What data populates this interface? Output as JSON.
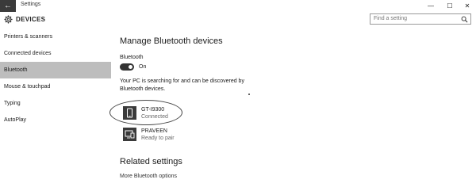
{
  "window": {
    "title": "Settings",
    "back_icon": "back-arrow-icon",
    "controls": {
      "minimize": "—",
      "maximize": "☐",
      "close": "✕"
    }
  },
  "header": {
    "icon": "gear-icon",
    "title": "DEVICES",
    "search_placeholder": "Find a setting"
  },
  "sidebar": {
    "items": [
      {
        "label": "Printers & scanners",
        "active": false
      },
      {
        "label": "Connected devices",
        "active": false
      },
      {
        "label": "Bluetooth",
        "active": true
      },
      {
        "label": "Mouse & touchpad",
        "active": false
      },
      {
        "label": "Typing",
        "active": false
      },
      {
        "label": "AutoPlay",
        "active": false
      }
    ]
  },
  "main": {
    "title": "Manage Bluetooth devices",
    "bluetooth_label": "Bluetooth",
    "bluetooth_state": "On",
    "description": "Your PC is searching for and can be discovered by Bluetooth devices.",
    "devices": [
      {
        "name": "GT-I9300",
        "status": "Connected",
        "icon": "phone-icon"
      },
      {
        "name": "PRAVEEN",
        "status": "Ready to pair",
        "icon": "computer-icon"
      }
    ],
    "related_title": "Related settings",
    "related_link": "More Bluetooth options"
  }
}
